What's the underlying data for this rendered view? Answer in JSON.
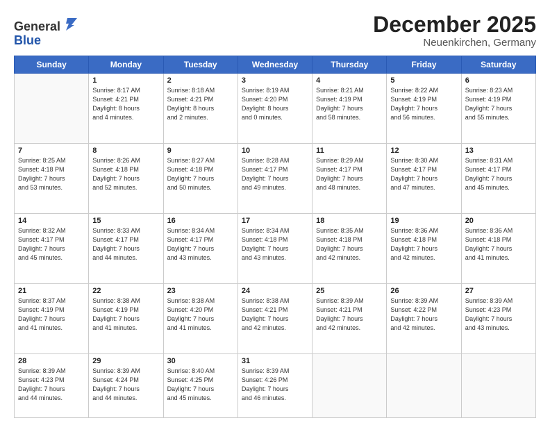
{
  "header": {
    "logo_line1": "General",
    "logo_line2": "Blue",
    "month": "December 2025",
    "location": "Neuenkirchen, Germany"
  },
  "weekdays": [
    "Sunday",
    "Monday",
    "Tuesday",
    "Wednesday",
    "Thursday",
    "Friday",
    "Saturday"
  ],
  "weeks": [
    [
      {
        "day": "",
        "info": ""
      },
      {
        "day": "1",
        "info": "Sunrise: 8:17 AM\nSunset: 4:21 PM\nDaylight: 8 hours\nand 4 minutes."
      },
      {
        "day": "2",
        "info": "Sunrise: 8:18 AM\nSunset: 4:21 PM\nDaylight: 8 hours\nand 2 minutes."
      },
      {
        "day": "3",
        "info": "Sunrise: 8:19 AM\nSunset: 4:20 PM\nDaylight: 8 hours\nand 0 minutes."
      },
      {
        "day": "4",
        "info": "Sunrise: 8:21 AM\nSunset: 4:19 PM\nDaylight: 7 hours\nand 58 minutes."
      },
      {
        "day": "5",
        "info": "Sunrise: 8:22 AM\nSunset: 4:19 PM\nDaylight: 7 hours\nand 56 minutes."
      },
      {
        "day": "6",
        "info": "Sunrise: 8:23 AM\nSunset: 4:19 PM\nDaylight: 7 hours\nand 55 minutes."
      }
    ],
    [
      {
        "day": "7",
        "info": "Sunrise: 8:25 AM\nSunset: 4:18 PM\nDaylight: 7 hours\nand 53 minutes."
      },
      {
        "day": "8",
        "info": "Sunrise: 8:26 AM\nSunset: 4:18 PM\nDaylight: 7 hours\nand 52 minutes."
      },
      {
        "day": "9",
        "info": "Sunrise: 8:27 AM\nSunset: 4:18 PM\nDaylight: 7 hours\nand 50 minutes."
      },
      {
        "day": "10",
        "info": "Sunrise: 8:28 AM\nSunset: 4:17 PM\nDaylight: 7 hours\nand 49 minutes."
      },
      {
        "day": "11",
        "info": "Sunrise: 8:29 AM\nSunset: 4:17 PM\nDaylight: 7 hours\nand 48 minutes."
      },
      {
        "day": "12",
        "info": "Sunrise: 8:30 AM\nSunset: 4:17 PM\nDaylight: 7 hours\nand 47 minutes."
      },
      {
        "day": "13",
        "info": "Sunrise: 8:31 AM\nSunset: 4:17 PM\nDaylight: 7 hours\nand 45 minutes."
      }
    ],
    [
      {
        "day": "14",
        "info": "Sunrise: 8:32 AM\nSunset: 4:17 PM\nDaylight: 7 hours\nand 45 minutes."
      },
      {
        "day": "15",
        "info": "Sunrise: 8:33 AM\nSunset: 4:17 PM\nDaylight: 7 hours\nand 44 minutes."
      },
      {
        "day": "16",
        "info": "Sunrise: 8:34 AM\nSunset: 4:17 PM\nDaylight: 7 hours\nand 43 minutes."
      },
      {
        "day": "17",
        "info": "Sunrise: 8:34 AM\nSunset: 4:18 PM\nDaylight: 7 hours\nand 43 minutes."
      },
      {
        "day": "18",
        "info": "Sunrise: 8:35 AM\nSunset: 4:18 PM\nDaylight: 7 hours\nand 42 minutes."
      },
      {
        "day": "19",
        "info": "Sunrise: 8:36 AM\nSunset: 4:18 PM\nDaylight: 7 hours\nand 42 minutes."
      },
      {
        "day": "20",
        "info": "Sunrise: 8:36 AM\nSunset: 4:18 PM\nDaylight: 7 hours\nand 41 minutes."
      }
    ],
    [
      {
        "day": "21",
        "info": "Sunrise: 8:37 AM\nSunset: 4:19 PM\nDaylight: 7 hours\nand 41 minutes."
      },
      {
        "day": "22",
        "info": "Sunrise: 8:38 AM\nSunset: 4:19 PM\nDaylight: 7 hours\nand 41 minutes."
      },
      {
        "day": "23",
        "info": "Sunrise: 8:38 AM\nSunset: 4:20 PM\nDaylight: 7 hours\nand 41 minutes."
      },
      {
        "day": "24",
        "info": "Sunrise: 8:38 AM\nSunset: 4:21 PM\nDaylight: 7 hours\nand 42 minutes."
      },
      {
        "day": "25",
        "info": "Sunrise: 8:39 AM\nSunset: 4:21 PM\nDaylight: 7 hours\nand 42 minutes."
      },
      {
        "day": "26",
        "info": "Sunrise: 8:39 AM\nSunset: 4:22 PM\nDaylight: 7 hours\nand 42 minutes."
      },
      {
        "day": "27",
        "info": "Sunrise: 8:39 AM\nSunset: 4:23 PM\nDaylight: 7 hours\nand 43 minutes."
      }
    ],
    [
      {
        "day": "28",
        "info": "Sunrise: 8:39 AM\nSunset: 4:23 PM\nDaylight: 7 hours\nand 44 minutes."
      },
      {
        "day": "29",
        "info": "Sunrise: 8:39 AM\nSunset: 4:24 PM\nDaylight: 7 hours\nand 44 minutes."
      },
      {
        "day": "30",
        "info": "Sunrise: 8:40 AM\nSunset: 4:25 PM\nDaylight: 7 hours\nand 45 minutes."
      },
      {
        "day": "31",
        "info": "Sunrise: 8:39 AM\nSunset: 4:26 PM\nDaylight: 7 hours\nand 46 minutes."
      },
      {
        "day": "",
        "info": ""
      },
      {
        "day": "",
        "info": ""
      },
      {
        "day": "",
        "info": ""
      }
    ]
  ]
}
